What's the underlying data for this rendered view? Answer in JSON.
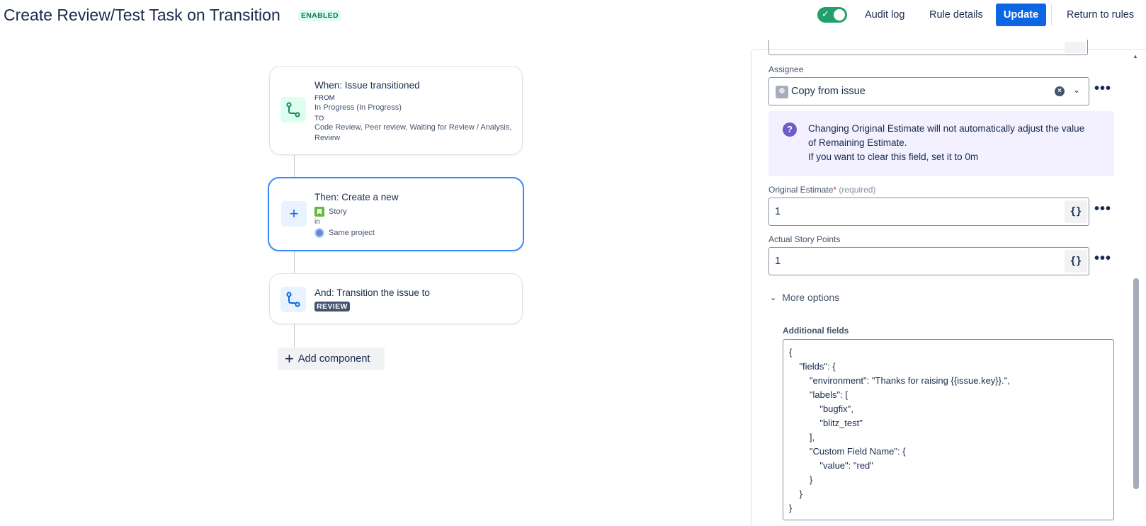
{
  "header": {
    "title": "Create Review/Test Task on Transition",
    "status_badge": "ENABLED",
    "audit_log": "Audit log",
    "rule_details": "Rule details",
    "update": "Update",
    "return_to_rules": "Return to rules"
  },
  "flow": {
    "trigger": {
      "title": "When: Issue transitioned",
      "from_label": "FROM",
      "from_value": "In Progress (In Progress)",
      "to_label": "TO",
      "to_value_line1": "Code Review, Peer review, Waiting for Review / Analysis,",
      "to_value_line2": "Review"
    },
    "action_create": {
      "title": "Then: Create a new",
      "issue_type": "Story",
      "in_label": "in",
      "project": "Same project"
    },
    "action_transition": {
      "title": "And: Transition the issue to",
      "status": "REVIEW"
    },
    "add_component": "Add component"
  },
  "panel": {
    "assignee_label": "Assignee",
    "assignee_value": "Copy from issue",
    "info_line1": "Changing Original Estimate will not automatically adjust the value",
    "info_line2": "of Remaining Estimate.",
    "info_line3": "If you want to clear this field, set it to 0m",
    "original_estimate_label": "Original Estimate",
    "required_star": "*",
    "required_text": "(required)",
    "original_estimate_value": "1",
    "story_points_label": "Actual Story Points",
    "story_points_value": "1",
    "smart_value_btn": "{}",
    "more_options": "More options",
    "additional_fields_label": "Additional fields",
    "additional_fields_lines": [
      "{",
      "    \"fields\": {",
      "        \"environment\": \"Thanks for raising {{issue.key}}.\",",
      "        \"labels\": [",
      "            \"bugfix\",",
      "            \"blitz_test\"",
      "        ],",
      "        \"Custom Field Name\": {",
      "            \"value\": \"red\"",
      "        }",
      "    }",
      "}"
    ]
  },
  "colors": {
    "primary": "#0C66E4",
    "toggle_on": "#22A06B",
    "selected_border": "#388BFF",
    "info_bg": "#F3F0FF",
    "info_icon": "#6E5DC6"
  }
}
